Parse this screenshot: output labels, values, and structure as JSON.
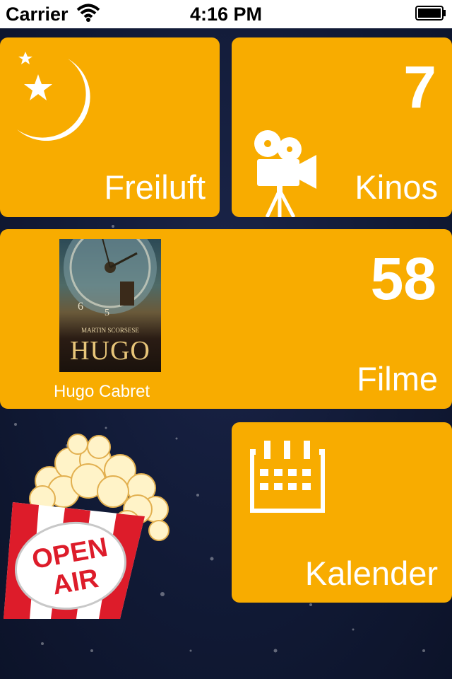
{
  "status_bar": {
    "carrier": "Carrier",
    "time": "4:16 PM"
  },
  "tiles": {
    "freiluft": {
      "label": "Freiluft",
      "icon": "moon-star-icon"
    },
    "kinos": {
      "count": "7",
      "label": "Kinos",
      "icon": "movie-camera-icon"
    },
    "filme": {
      "count": "58",
      "label": "Filme",
      "featured_movie": {
        "caption": "Hugo Cabret",
        "poster_title": "HUGO",
        "poster_credit": "MARTIN SCORSESE"
      }
    },
    "kalender": {
      "label": "Kalender",
      "icon": "calendar-icon"
    }
  },
  "branding": {
    "logo_lines": [
      "OPEN",
      "AIR"
    ]
  },
  "colors": {
    "tile": "#f8ac00",
    "background": "#111a36",
    "text": "#ffffff"
  }
}
